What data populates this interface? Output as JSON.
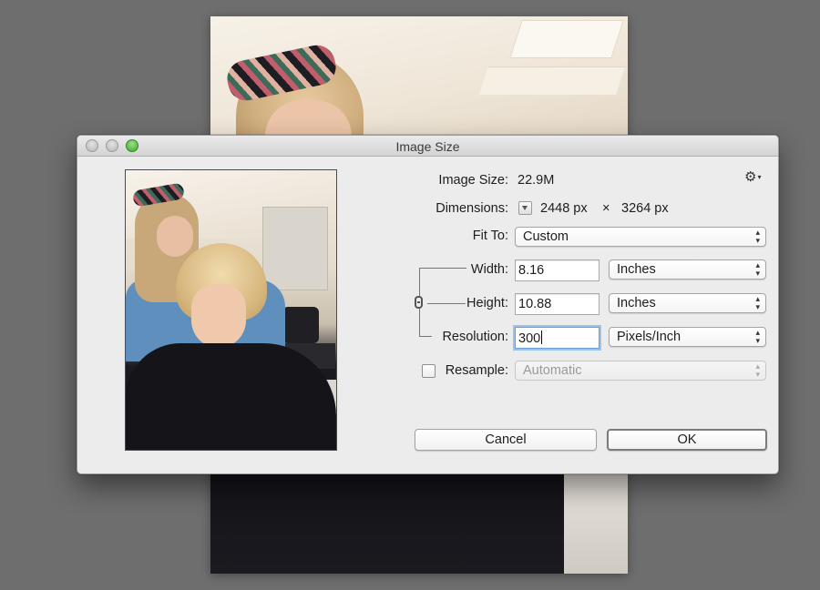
{
  "dialog": {
    "title": "Image Size",
    "image_size_label": "Image Size:",
    "image_size_value": "22.9M",
    "dimensions_label": "Dimensions:",
    "dimensions_width": "2448 px",
    "dimensions_separator": "×",
    "dimensions_height": "3264 px",
    "fit_to_label": "Fit To:",
    "fit_to_value": "Custom",
    "width_label": "Width:",
    "width_value": "8.16",
    "width_unit": "Inches",
    "height_label": "Height:",
    "height_value": "10.88",
    "height_unit": "Inches",
    "resolution_label": "Resolution:",
    "resolution_value": "300",
    "resolution_unit": "Pixels/Inch",
    "resample_label": "Resample:",
    "resample_checked": false,
    "resample_value": "Automatic",
    "cancel_label": "Cancel",
    "ok_label": "OK",
    "select_arrows": "▴\n▾"
  },
  "icons": {
    "gear": "gear-icon",
    "link": "link-icon",
    "dimensions_menu": "triangle-down-icon"
  },
  "colors": {
    "window_bg": "#ececec",
    "focus_ring": "#9cc3ee",
    "zoom_button": "#3fa431"
  }
}
